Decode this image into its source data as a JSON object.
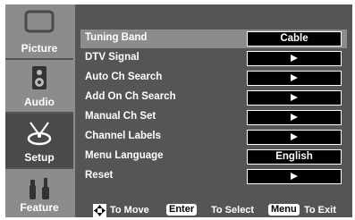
{
  "sidebar": {
    "items": [
      {
        "label": "Picture"
      },
      {
        "label": "Audio"
      },
      {
        "label": "Setup"
      },
      {
        "label": "Feature"
      }
    ]
  },
  "menu": {
    "rows": [
      {
        "label": "Tuning Band",
        "value": "Cable"
      },
      {
        "label": "DTV Signal"
      },
      {
        "label": "Auto Ch Search"
      },
      {
        "label": "Add On Ch Search"
      },
      {
        "label": "Manual Ch Set"
      },
      {
        "label": "Channel Labels"
      },
      {
        "label": "Menu Language",
        "value": "English"
      },
      {
        "label": "Reset"
      }
    ]
  },
  "footer": {
    "move_text": "To Move",
    "enter_key": "Enter",
    "select_text": "To Select",
    "menu_key": "Menu",
    "exit_text": "To Exit"
  },
  "colors": {
    "background": "#555555",
    "sidebar_inactive": "#8c8c8c",
    "highlight_row": "#8c8c8c",
    "value_box": "#000000",
    "text": "#ffffff"
  },
  "icons": [
    "monitor-icon",
    "speaker-icon",
    "satellite-dish-icon",
    "tools-icon",
    "dpad-icon",
    "arrow-right-icon"
  ]
}
